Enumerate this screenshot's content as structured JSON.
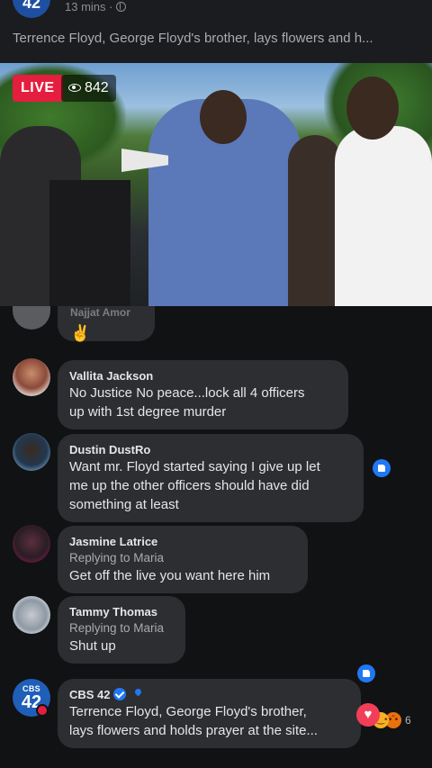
{
  "header": {
    "page_initials": "42",
    "time_ago": "13 mins ·",
    "caption": "Terrence Floyd, George Floyd's brother, lays flowers and h..."
  },
  "video": {
    "live_label": "LIVE",
    "viewer_count": "842"
  },
  "partial_comment": {
    "name": "Najjat Amor",
    "emoji": "✌"
  },
  "comments": [
    {
      "name": "Vallita Jackson",
      "reply_to": "",
      "lines": [
        "No Justice No peace...lock all 4 officers",
        "up with 1st degree murder"
      ]
    },
    {
      "name": "Dustin DustRo",
      "reply_to": "",
      "lines": [
        "Want mr. Floyd started saying I give up let",
        "me up the other officers should have did",
        "something at least"
      ]
    },
    {
      "name": "Jasmine Latrice",
      "reply_to": "Replying to Maria",
      "lines": [
        "Get off the live you want here him"
      ]
    },
    {
      "name": "Tammy Thomas",
      "reply_to": "Replying to Maria",
      "lines": [
        "Shut up"
      ]
    },
    {
      "name": "CBS 42",
      "reply_to": "",
      "lines": [
        "Terrence Floyd, George Floyd's brother,",
        "lays flowers and holds prayer at the site..."
      ]
    }
  ],
  "cbs_avatar": {
    "top": "CBS",
    "num": "42"
  },
  "reactions": {
    "count": "6"
  },
  "colors": {
    "live": "#e41e3f",
    "bubble": "#2d2e31",
    "like_blue": "#2078f4",
    "background": "#111214"
  }
}
